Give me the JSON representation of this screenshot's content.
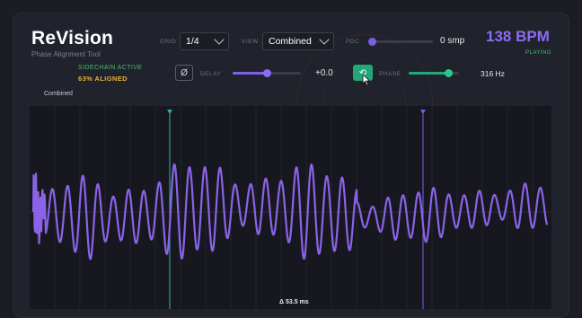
{
  "header": {
    "title": "ReVision",
    "subtitle": "Phase Alignment Tool"
  },
  "grid": {
    "label": "GRID",
    "value": "1/4"
  },
  "view": {
    "label": "VIEW",
    "value": "Combined"
  },
  "pdc": {
    "label": "PDC",
    "value": "0 smp",
    "slider_level": 0.0
  },
  "transport": {
    "bpm": "138 BPM",
    "state": "PLAYING"
  },
  "status": {
    "sidechain": "SIDECHAIN ACTIVE",
    "aligned": "63% ALIGNED"
  },
  "delay": {
    "label": "DELAY",
    "value": "+0.0",
    "slider_level": 0.5,
    "invert_symbol": "Ø"
  },
  "phase": {
    "label": "PHASE",
    "value": "316 Hz",
    "slider_level": 0.88,
    "link_symbol": "⟲"
  },
  "waveform": {
    "mode_label": "Combined",
    "delta_readout": "Δ 53.5 ms"
  },
  "colors": {
    "accent": "#8c6cf3",
    "waveform": "#8a63e8",
    "active_green": "#3fbf6f",
    "aligned_amber": "#e8b23a",
    "marker_teal": "#2fb3a3",
    "marker_purple": "#7c5fe6"
  },
  "icons": {
    "grid_dropdown": "chevron-down-icon",
    "view_dropdown": "chevron-down-icon",
    "invert_button": "phase-invert-icon",
    "link_button": "link-icon",
    "pointer": "mouse-cursor-icon"
  }
}
